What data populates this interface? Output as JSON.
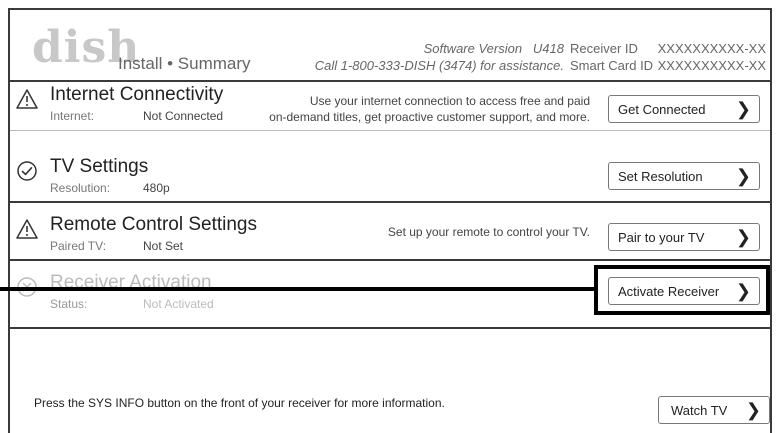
{
  "header": {
    "logo": "dish",
    "subtitle": "Install • Summary",
    "software_version_label": "Software Version",
    "software_version": "U418",
    "support_line": "Call 1-800-333-DISH (3474) for assistance.",
    "receiver_id_label": "Receiver ID",
    "receiver_id": "XXXXXXXXXX-XX",
    "smart_card_label": "Smart Card ID",
    "smart_card_id": "XXXXXXXXXX-XX"
  },
  "rows": [
    {
      "title": "Internet Connectivity",
      "status_label": "Internet:",
      "status_value": "Not Connected",
      "description_line1": "Use your internet connection to access free and paid",
      "description_line2": "on-demand titles, get proactive customer support, and more.",
      "button": "Get Connected",
      "icon": "warning-icon"
    },
    {
      "title": "TV Settings",
      "status_label": "Resolution:",
      "status_value": "480p",
      "description_line1": "",
      "description_line2": "",
      "button": "Set Resolution",
      "icon": "check-circle-icon"
    },
    {
      "title": "Remote Control Settings",
      "status_label": "Paired TV:",
      "status_value": "Not Set",
      "description_line1": "Set up your remote to control your TV.",
      "description_line2": "",
      "button": "Pair to your TV",
      "icon": "warning-icon"
    },
    {
      "title": "Receiver Activation",
      "status_label": "Status:",
      "status_value": "Not Activated",
      "description_line1": "",
      "description_line2": "",
      "button": "Activate Receiver",
      "icon": "x-circle-icon"
    }
  ],
  "footer": {
    "note": "Press the SYS INFO button on the front of your receiver for more information.",
    "watch_tv": "Watch TV"
  },
  "colors": {
    "border": "#3a3a3a",
    "muted": "#777777",
    "highlight": "#000000"
  }
}
